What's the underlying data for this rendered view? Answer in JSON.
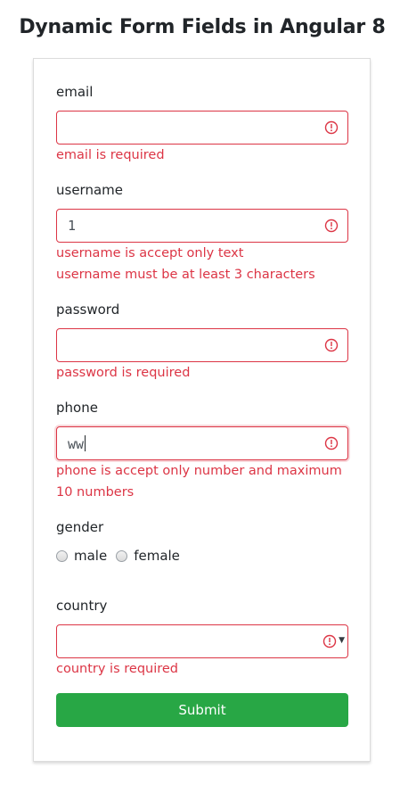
{
  "page": {
    "title": "Dynamic Form Fields in Angular 8"
  },
  "form": {
    "email": {
      "label": "email",
      "value": "",
      "errors": [
        "email is required"
      ]
    },
    "username": {
      "label": "username",
      "value": "1",
      "errors": [
        "username is accept only text",
        "username must be at least 3 characters"
      ]
    },
    "password": {
      "label": "password",
      "value": "",
      "errors": [
        "password is required"
      ]
    },
    "phone": {
      "label": "phone",
      "value": "ww",
      "errors": [
        "phone is accept only number and maximum 10 numbers"
      ]
    },
    "gender": {
      "label": "gender",
      "options": [
        "male",
        "female"
      ],
      "selected": null
    },
    "country": {
      "label": "country",
      "value": "",
      "errors": [
        "country is required"
      ]
    },
    "submit_label": "Submit"
  },
  "colors": {
    "error": "#dc3545",
    "submit": "#28a745"
  },
  "icons": {
    "invalid": "exclamation-circle-icon",
    "dropdown": "caret-down-icon"
  }
}
